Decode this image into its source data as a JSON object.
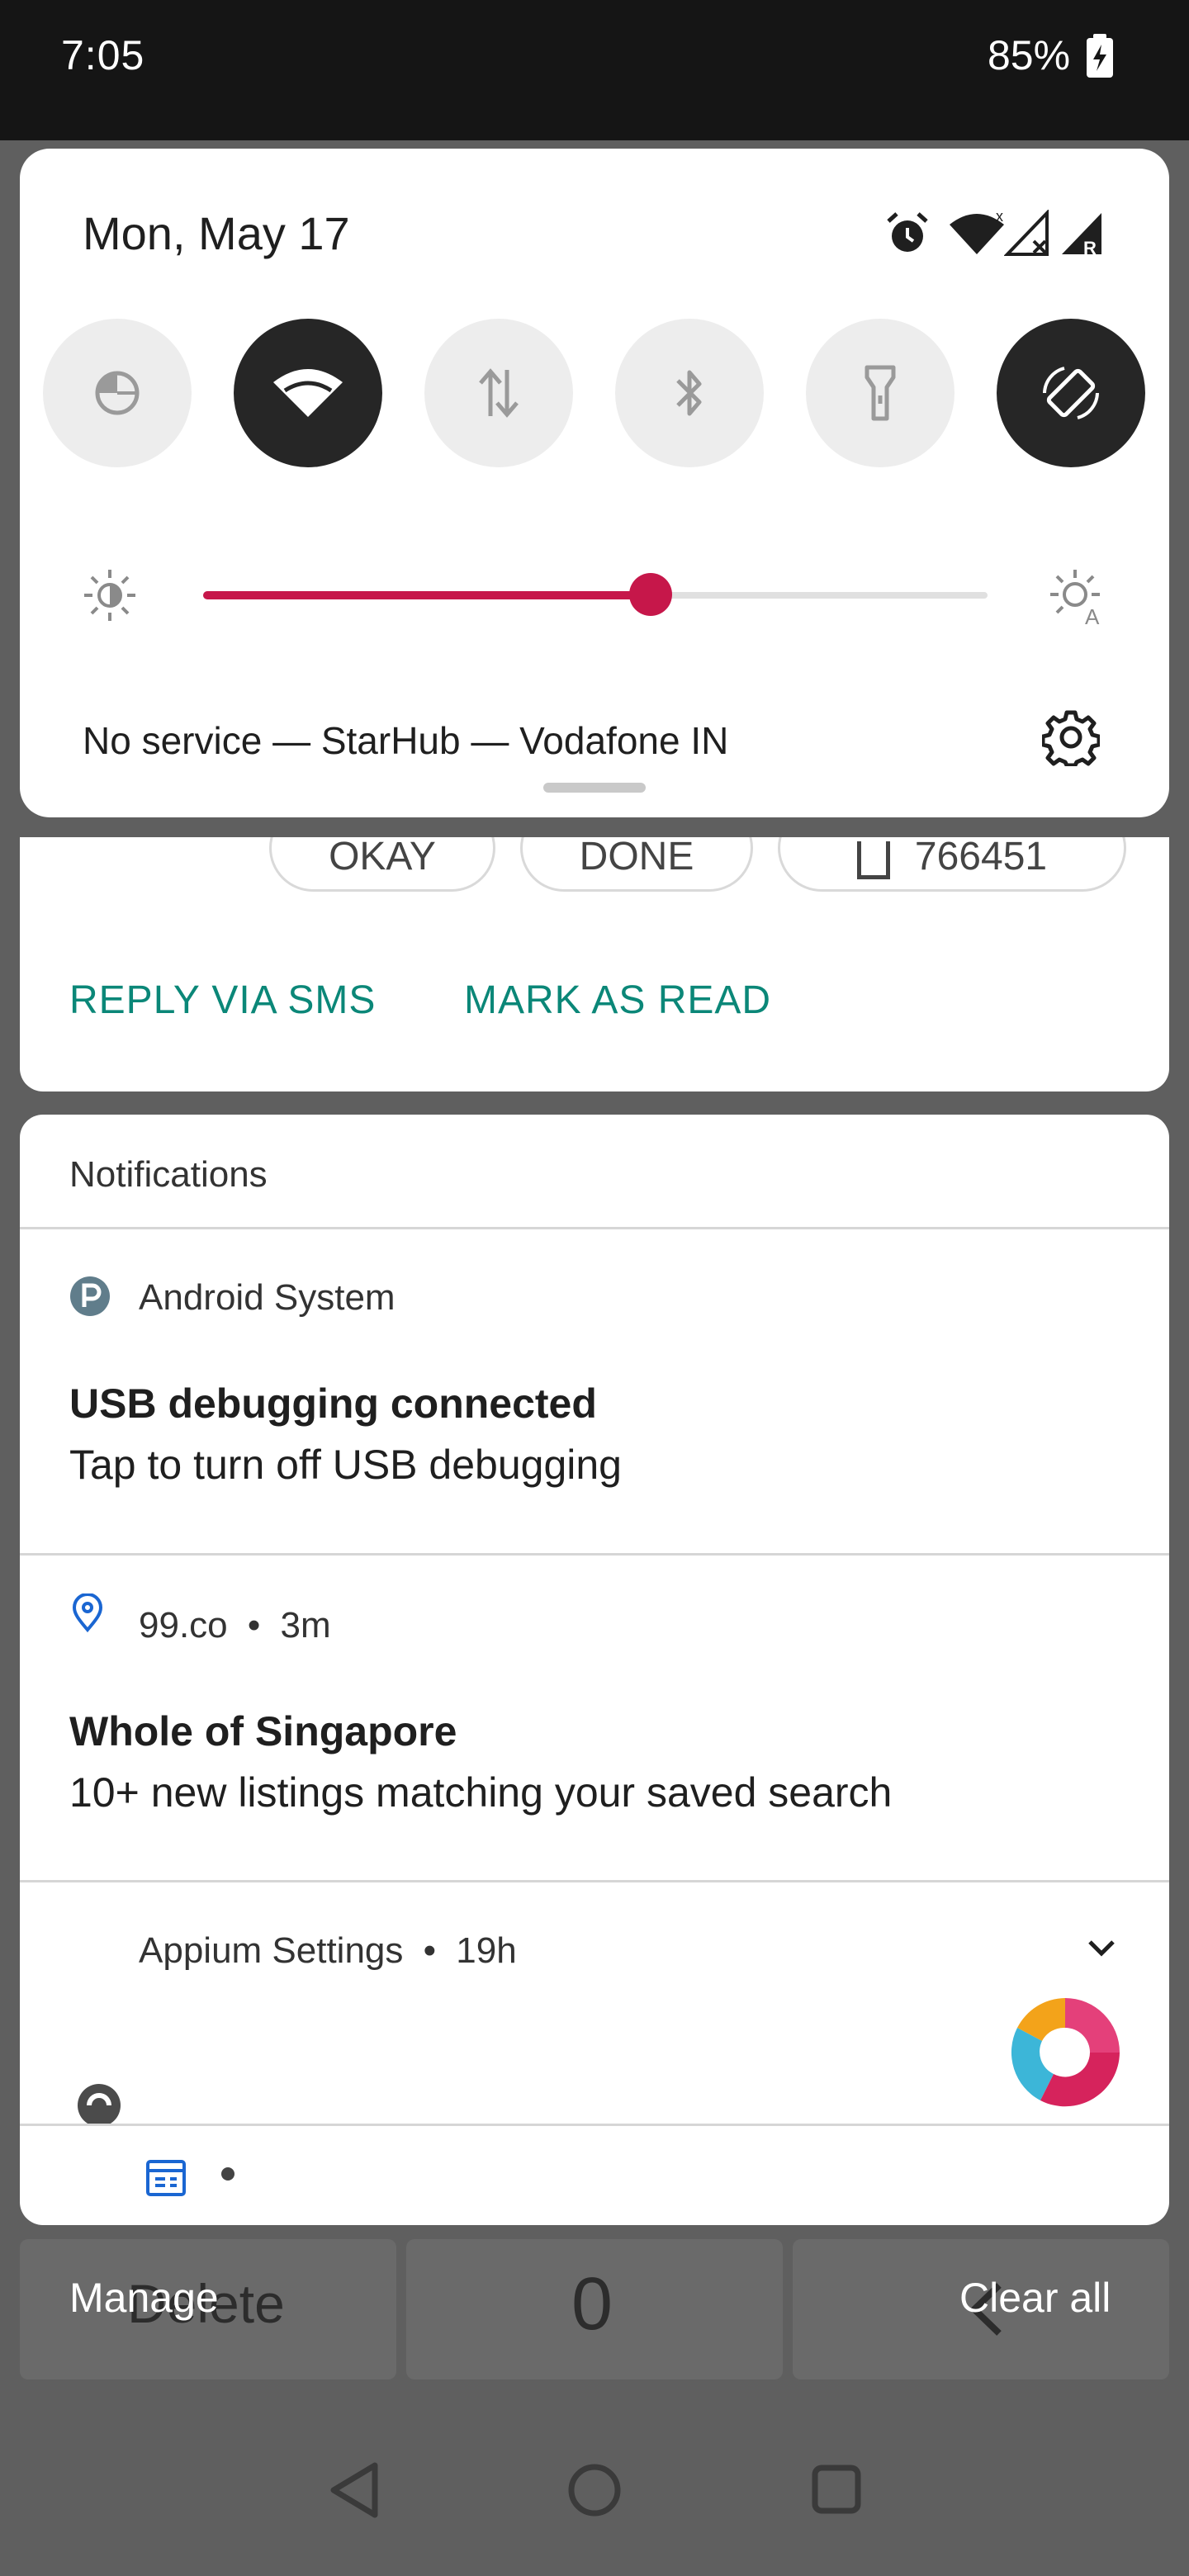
{
  "status_bar": {
    "time": "7:05",
    "battery": "85%"
  },
  "quick_settings": {
    "date": "Mon, May 17",
    "tiles": [
      {
        "name": "data-saver",
        "active": false
      },
      {
        "name": "wifi",
        "active": true
      },
      {
        "name": "mobile-data",
        "active": false
      },
      {
        "name": "bluetooth",
        "active": false
      },
      {
        "name": "flashlight",
        "active": false
      },
      {
        "name": "auto-rotate",
        "active": true
      }
    ],
    "brightness_level": 0.57,
    "carrier": "No service — StarHub — Vodafone IN",
    "accent_color": "#c6174a"
  },
  "sms_notification": {
    "chips": [
      "OKAY",
      "DONE",
      "766451"
    ],
    "actions": {
      "reply": "REPLY VIA SMS",
      "mark_read": "MARK AS READ"
    },
    "action_color": "#0b8778"
  },
  "notifications": {
    "section_title": "Notifications",
    "items": [
      {
        "app": "Android System",
        "time": "",
        "title": "USB debugging connected",
        "text": "Tap to turn off USB debugging"
      },
      {
        "app": "99.co",
        "time": "3m",
        "title": "Whole of Singapore",
        "text": "10+ new listings matching your saved search"
      },
      {
        "app": "Appium Settings",
        "time": "19h"
      }
    ],
    "bullet": "•"
  },
  "footer": {
    "manage": "Manage",
    "clear_all": "Clear all"
  },
  "background_app": {
    "keys": [
      "Delete",
      "0"
    ]
  }
}
